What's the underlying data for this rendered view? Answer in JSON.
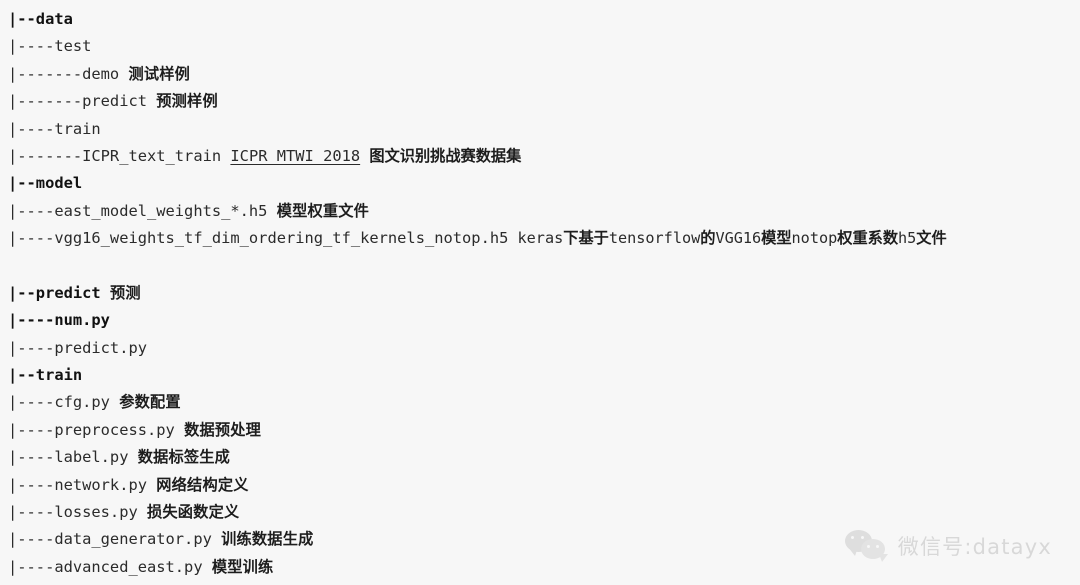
{
  "page": {
    "background_color": "#f7f7f7",
    "text_color": "#2b2b2b"
  },
  "tree": {
    "lines": [
      {
        "type": "entry",
        "path": "|--data",
        "bold": true,
        "note": ""
      },
      {
        "type": "entry",
        "path": "|----test",
        "bold": false,
        "note": ""
      },
      {
        "type": "entry",
        "path": "|-------demo",
        "bold": false,
        "note": "测试样例"
      },
      {
        "type": "entry",
        "path": "|-------predict",
        "bold": false,
        "note": "预测样例"
      },
      {
        "type": "entry",
        "path": "|----train",
        "bold": false,
        "note": ""
      },
      {
        "type": "link",
        "path": "|-------ICPR_text_train",
        "bold": false,
        "link_text": "ICPR MTWI 2018",
        "note": "图文识别挑战赛数据集"
      },
      {
        "type": "entry",
        "path": "|--model",
        "bold": true,
        "note": ""
      },
      {
        "type": "entry",
        "path": "|----east_model_weights_*.h5",
        "bold": false,
        "note": "模型权重文件"
      },
      {
        "type": "mixed",
        "path": "|----vgg16_weights_tf_dim_ordering_tf_kernels_notop.h5",
        "bold": false,
        "tail": [
          {
            "k": "m",
            "t": " keras"
          },
          {
            "k": "c",
            "t": "下基于"
          },
          {
            "k": "m",
            "t": "tensorflow"
          },
          {
            "k": "c",
            "t": "的"
          },
          {
            "k": "m",
            "t": "VGG16"
          },
          {
            "k": "c",
            "t": "模型"
          },
          {
            "k": "m",
            "t": "notop"
          },
          {
            "k": "c",
            "t": "权重系数"
          },
          {
            "k": "m",
            "t": "h5"
          },
          {
            "k": "c",
            "t": "文件"
          }
        ]
      },
      {
        "type": "spacer"
      },
      {
        "type": "entry",
        "path": "|--predict",
        "bold": true,
        "note": "预测"
      },
      {
        "type": "entry",
        "path": "|----num.py",
        "bold": true,
        "note": ""
      },
      {
        "type": "entry",
        "path": "|----predict.py",
        "bold": false,
        "note": ""
      },
      {
        "type": "entry",
        "path": "|--train",
        "bold": true,
        "note": ""
      },
      {
        "type": "entry",
        "path": "|----cfg.py",
        "bold": false,
        "note": "参数配置"
      },
      {
        "type": "entry",
        "path": "|----preprocess.py",
        "bold": false,
        "note": "数据预处理"
      },
      {
        "type": "entry",
        "path": "|----label.py",
        "bold": false,
        "note": "数据标签生成"
      },
      {
        "type": "entry",
        "path": "|----network.py",
        "bold": false,
        "note": "网络结构定义"
      },
      {
        "type": "entry",
        "path": "|----losses.py",
        "bold": false,
        "note": "损失函数定义"
      },
      {
        "type": "entry",
        "path": "|----data_generator.py",
        "bold": false,
        "note": "训练数据生成"
      },
      {
        "type": "entry",
        "path": "|----advanced_east.py",
        "bold": false,
        "note": "模型训练"
      }
    ]
  },
  "watermark": {
    "icon": "wechat-logo-icon",
    "text": "微信号:datayx",
    "color": "#d6d6d6"
  }
}
